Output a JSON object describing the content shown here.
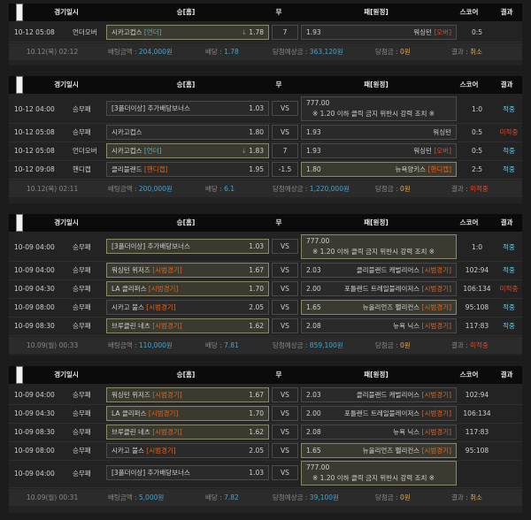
{
  "header": {
    "time": "경기일시",
    "type": "",
    "home": "승[홈]",
    "draw": "무",
    "away": "패[원정]",
    "score": "스코어",
    "result": "결과"
  },
  "labels": {
    "bet_amount": "배팅금액",
    "odds": "배당",
    "expected": "당첨예상금",
    "won": "당첨금",
    "result": "결과",
    "vs": "VS",
    "notice_odds": "777.00",
    "notice_text": "※ 1.20 이하 클릭 금지 위반시 강력 조치 ※"
  },
  "slips": [
    {
      "rows": [
        {
          "time": "10-12 05:08",
          "type": "언더오버",
          "home": "시카고컵스",
          "home_tag": "[언더]",
          "home_tag_color": "blue",
          "home_odds": "1.78",
          "home_arrow": "↓",
          "home_sel": true,
          "mid": "7",
          "away": "워싱턴",
          "away_tag": "[오버]",
          "away_tag_color": "red",
          "away_odds": "1.93",
          "away_sel": false,
          "score": "0:5",
          "result": "",
          "result_color": ""
        }
      ],
      "summary": {
        "date": "10.12(목) 02:12",
        "bet": "204,000원",
        "odds": "1.78",
        "expected": "363,120원",
        "won": "0원",
        "result": "취소",
        "result_color": "cancel"
      }
    },
    {
      "rows": [
        {
          "notice": "home",
          "time": "10-12 04:00",
          "type": "승무패",
          "home": "[3폴더이상] 추가배당보너스",
          "home_odds": "1.03",
          "home_sel": false,
          "mid": "VS",
          "score": "1:0",
          "result": "적중",
          "result_color": "win"
        },
        {
          "time": "10-12 05:08",
          "type": "승무패",
          "home": "시카고컵스",
          "home_odds": "1.80",
          "home_sel": false,
          "mid": "VS",
          "away": "워싱턴",
          "away_odds": "1.93",
          "away_sel": false,
          "score": "0:5",
          "result": "미적중",
          "result_color": "lose"
        },
        {
          "time": "10-12 05:08",
          "type": "언더오버",
          "home": "시카고컵스",
          "home_tag": "[언더]",
          "home_tag_color": "blue",
          "home_odds": "1.83",
          "home_arrow": "↓",
          "home_sel": true,
          "mid": "7",
          "away": "워싱턴",
          "away_tag": "[오버]",
          "away_tag_color": "red",
          "away_odds": "1.93",
          "away_sel": false,
          "score": "0:5",
          "result": "적중",
          "result_color": "win"
        },
        {
          "time": "10-12 09:08",
          "type": "핸디캡",
          "home": "클리블랜드",
          "home_tag": "[핸디캡]",
          "home_tag_color": "orange",
          "home_odds": "1.95",
          "home_sel": false,
          "mid": "-1.5",
          "away": "뉴욕양키스",
          "away_tag": "[핸디캡]",
          "away_tag_color": "orange",
          "away_odds": "1.80",
          "away_sel": true,
          "score": "2:5",
          "result": "적중",
          "result_color": "win"
        }
      ],
      "summary": {
        "date": "10.12(목) 02:11",
        "bet": "200,000원",
        "odds": "6.1",
        "expected": "1,220,000원",
        "won": "0원",
        "result": "미적중",
        "result_color": "lose"
      }
    },
    {
      "rows": [
        {
          "notice": "away",
          "time": "10-09 04:00",
          "type": "승무패",
          "home": "[3폴더이상] 추가배당보너스",
          "home_odds": "1.03",
          "home_sel": true,
          "mid": "VS",
          "score": "1:0",
          "result": "적중",
          "result_color": "win"
        },
        {
          "time": "10-09 04:00",
          "type": "승무패",
          "home": "워싱턴 위저즈",
          "home_tag": "[시범경기]",
          "home_tag_color": "orange",
          "home_odds": "1.67",
          "home_sel": true,
          "mid": "VS",
          "away": "클리블랜드 캐벌리어스",
          "away_tag": "[시범경기]",
          "away_tag_color": "orange",
          "away_odds": "2.03",
          "away_sel": false,
          "score": "102:94",
          "result": "적중",
          "result_color": "win"
        },
        {
          "time": "10-09 04:30",
          "type": "승무패",
          "home": "LA 클리퍼스",
          "home_tag": "[시범경기]",
          "home_tag_color": "orange",
          "home_odds": "1.70",
          "home_sel": true,
          "mid": "VS",
          "away": "포틀랜드 트레일블레이저스",
          "away_tag": "[시범경기]",
          "away_tag_color": "orange",
          "away_odds": "2.00",
          "away_sel": false,
          "score": "106:134",
          "result": "미적중",
          "result_color": "lose"
        },
        {
          "time": "10-09 08:00",
          "type": "승무패",
          "home": "시카고 불스",
          "home_tag": "[시범경기]",
          "home_tag_color": "orange",
          "home_odds": "2.05",
          "home_sel": false,
          "mid": "VS",
          "away": "뉴올리언즈 펠리컨스",
          "away_tag": "[시범경기]",
          "away_tag_color": "orange",
          "away_odds": "1.65",
          "away_sel": true,
          "score": "95:108",
          "result": "적중",
          "result_color": "win"
        },
        {
          "time": "10-09 08:30",
          "type": "승무패",
          "home": "브루클린 네츠",
          "home_tag": "[시범경기]",
          "home_tag_color": "orange",
          "home_odds": "1.62",
          "home_sel": true,
          "mid": "VS",
          "away": "뉴욕 닉스",
          "away_tag": "[시범경기]",
          "away_tag_color": "orange",
          "away_odds": "2.08",
          "away_sel": false,
          "score": "117:83",
          "result": "적중",
          "result_color": "win"
        }
      ],
      "summary": {
        "date": "10.09(월) 00:33",
        "bet": "110,000원",
        "odds": "7.81",
        "expected": "859,100원",
        "won": "0원",
        "result": "미적중",
        "result_color": "lose"
      }
    },
    {
      "rows": [
        {
          "time": "10-09 04:00",
          "type": "승무패",
          "home": "워싱턴 위저즈",
          "home_tag": "[시범경기]",
          "home_tag_color": "orange",
          "home_odds": "1.67",
          "home_sel": true,
          "mid": "VS",
          "away": "클리블랜드 캐벌리어스",
          "away_tag": "[시범경기]",
          "away_tag_color": "orange",
          "away_odds": "2.03",
          "away_sel": false,
          "score": "102:94",
          "result": "",
          "result_color": ""
        },
        {
          "time": "10-09 04:30",
          "type": "승무패",
          "home": "LA 클리퍼스",
          "home_tag": "[시범경기]",
          "home_tag_color": "orange",
          "home_odds": "1.70",
          "home_sel": true,
          "mid": "VS",
          "away": "포틀랜드 트레일블레이저스",
          "away_tag": "[시범경기]",
          "away_tag_color": "orange",
          "away_odds": "2.00",
          "away_sel": false,
          "score": "106:134",
          "result": "",
          "result_color": ""
        },
        {
          "time": "10-09 08:30",
          "type": "승무패",
          "home": "브루클린 네츠",
          "home_tag": "[시범경기]",
          "home_tag_color": "orange",
          "home_odds": "1.62",
          "home_sel": true,
          "mid": "VS",
          "away": "뉴욕 닉스",
          "away_tag": "[시범경기]",
          "away_tag_color": "orange",
          "away_odds": "2.08",
          "away_sel": false,
          "score": "117:83",
          "result": "",
          "result_color": ""
        },
        {
          "time": "10-09 08:00",
          "type": "승무패",
          "home": "시카고 불스",
          "home_tag": "[시범경기]",
          "home_tag_color": "orange",
          "home_odds": "2.05",
          "home_sel": false,
          "mid": "VS",
          "away": "뉴올리언즈 펠리컨스",
          "away_tag": "[시범경기]",
          "away_tag_color": "orange",
          "away_odds": "1.65",
          "away_sel": true,
          "score": "95:108",
          "result": "",
          "result_color": ""
        },
        {
          "notice": "away",
          "time": "10-09 04:00",
          "type": "승무패",
          "home": "[3폴더이상] 추가배당보너스",
          "home_odds": "1.03",
          "home_sel": false,
          "mid": "VS",
          "score": "",
          "result": "",
          "result_color": ""
        }
      ],
      "summary": {
        "date": "10.09(월) 00:31",
        "bet": "5,000원",
        "odds": "7.82",
        "expected": "39,100원",
        "won": "0원",
        "result": "취소",
        "result_color": "cancel"
      }
    }
  ]
}
